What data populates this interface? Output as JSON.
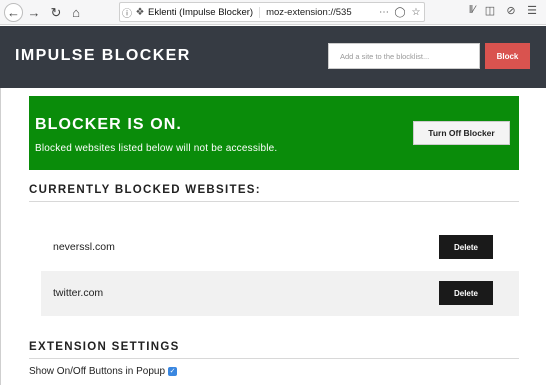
{
  "browser": {
    "tab_title": "Eklenti (Impulse Blocker)",
    "url": "moz-extension://535"
  },
  "header": {
    "title": "IMPULSE BLOCKER",
    "input_placeholder": "Add a site to the blocklist...",
    "block_label": "Block"
  },
  "status": {
    "title": "BLOCKER IS ON.",
    "description": "Blocked websites listed below will not be accessible.",
    "toggle_label": "Turn Off Blocker",
    "color": "#0a8c0a"
  },
  "blocked": {
    "heading": "CURRENTLY BLOCKED WEBSITES:",
    "sites": [
      {
        "name": "neverssl.com",
        "delete_label": "Delete"
      },
      {
        "name": "twitter.com",
        "delete_label": "Delete"
      }
    ]
  },
  "settings": {
    "heading": "EXTENSION SETTINGS",
    "show_buttons_label": "Show On/Off Buttons in Popup",
    "show_buttons_checked": true
  }
}
